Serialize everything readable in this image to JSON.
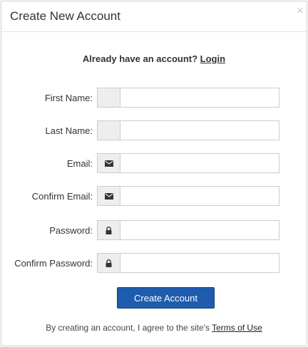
{
  "modal": {
    "title": "Create New Account",
    "close_icon": "close-icon"
  },
  "login_prompt": {
    "text": "Already have an account?",
    "link": "Login"
  },
  "fields": {
    "first_name": {
      "label": "First Name:",
      "value": "",
      "icon": ""
    },
    "last_name": {
      "label": "Last Name:",
      "value": "",
      "icon": ""
    },
    "email": {
      "label": "Email:",
      "value": "",
      "icon": "envelope-icon"
    },
    "confirm_email": {
      "label": "Confirm Email:",
      "value": "",
      "icon": "envelope-icon"
    },
    "password": {
      "label": "Password:",
      "value": "",
      "icon": "lock-icon"
    },
    "confirm_password": {
      "label": "Confirm Password:",
      "value": "",
      "icon": "lock-icon"
    }
  },
  "submit": {
    "label": "Create Account"
  },
  "terms": {
    "text": "By creating an account, I agree to the site's",
    "link": "Terms of Use"
  },
  "colors": {
    "button_bg": "#1f5cad",
    "addon_bg": "#eeeeee",
    "border": "#cccccc"
  }
}
